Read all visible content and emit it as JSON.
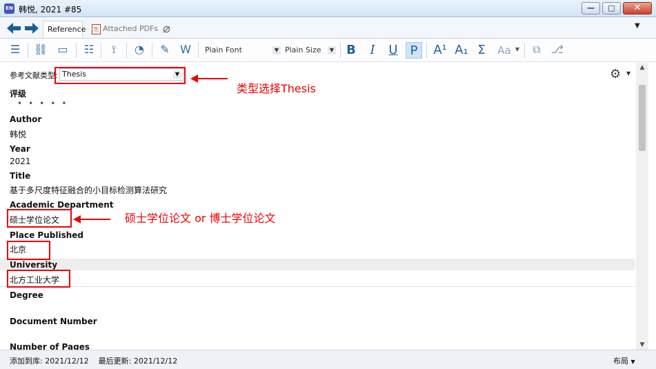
{
  "window": {
    "app_icon_text": "EN",
    "title": "韩悦, 2021 #85",
    "minimize_glyph": "—",
    "maximize_glyph": "□",
    "close_glyph": "✕"
  },
  "tabs": {
    "reference": "Reference",
    "attached_pdfs": "Attached PDFs",
    "menu_glyph": "▼"
  },
  "toolbar": {
    "font": "Plain Font",
    "size": "Plain Size",
    "bold": "B",
    "italic": "I",
    "underline": "U",
    "plain": "P",
    "superscript": "A¹",
    "subscript": "A₁",
    "symbol": "Σ",
    "case": "Aa"
  },
  "reference_type": {
    "label": "参考文献类型:",
    "value": "Thesis"
  },
  "fields": {
    "rating_label": "评级",
    "rating_dots": "•••••",
    "author_label": "Author",
    "author_value": "韩悦",
    "year_label": "Year",
    "year_value": "2021",
    "title_label": "Title",
    "title_value": "基于多尺度特征融合的小目标检测算法研究",
    "department_label": "Academic Department",
    "department_value": "硕士学位论文",
    "place_label": "Place Published",
    "place_value": "北京",
    "university_label": "University",
    "university_value": "北方工业大学",
    "degree_label": "Degree",
    "document_number_label": "Document Number",
    "pages_label": "Number of Pages"
  },
  "annotations": {
    "type_note": "类型选择Thesis",
    "department_note": "硕士学位论文 or 博士学位论文"
  },
  "status": {
    "added_label": "添加到库:",
    "added_value": "2021/12/12",
    "updated_label": "最后更新:",
    "updated_value": "2021/12/12",
    "layout": "布局"
  },
  "colors": {
    "annotation_red": "#ee0000",
    "accent_blue": "#1f5f9f"
  }
}
